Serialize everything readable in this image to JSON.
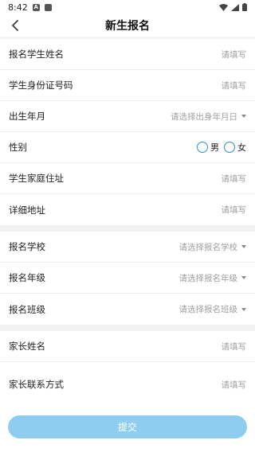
{
  "status_bar": {
    "time": "8:42",
    "icons": [
      "notification-a-icon",
      "notification-square-icon",
      "wifi-icon",
      "signal-icon",
      "battery-icon"
    ]
  },
  "header": {
    "title": "新生报名",
    "back_icon": "chevron-left-icon"
  },
  "form": {
    "student_name": {
      "label": "报名学生姓名",
      "placeholder": "请填写"
    },
    "id_number": {
      "label": "学生身份证号码",
      "placeholder": "请填写"
    },
    "birth_date": {
      "label": "出生年月",
      "placeholder": "请选择出身年月日"
    },
    "gender": {
      "label": "性别",
      "options": [
        "男",
        "女"
      ]
    },
    "home_address": {
      "label": "学生家庭住址",
      "placeholder": "请填写"
    },
    "detail_address": {
      "label": "详细地址",
      "placeholder": "请填写"
    },
    "school": {
      "label": "报名学校",
      "placeholder": "请选择报名学校"
    },
    "grade": {
      "label": "报名年级",
      "placeholder": "请选择报名年级"
    },
    "class": {
      "label": "报名班级",
      "placeholder": "请选择报名班级"
    },
    "parent_name": {
      "label": "家长姓名",
      "placeholder": "请填写"
    },
    "parent_contact": {
      "label": "家长联系方式",
      "placeholder": "请填写"
    }
  },
  "submit": {
    "label": "提交"
  },
  "colors": {
    "accent": "#2a8fd6",
    "submit_bg": "#8fcdf0",
    "placeholder": "#a0a0a0",
    "section_gap": "#f2f2f2"
  }
}
